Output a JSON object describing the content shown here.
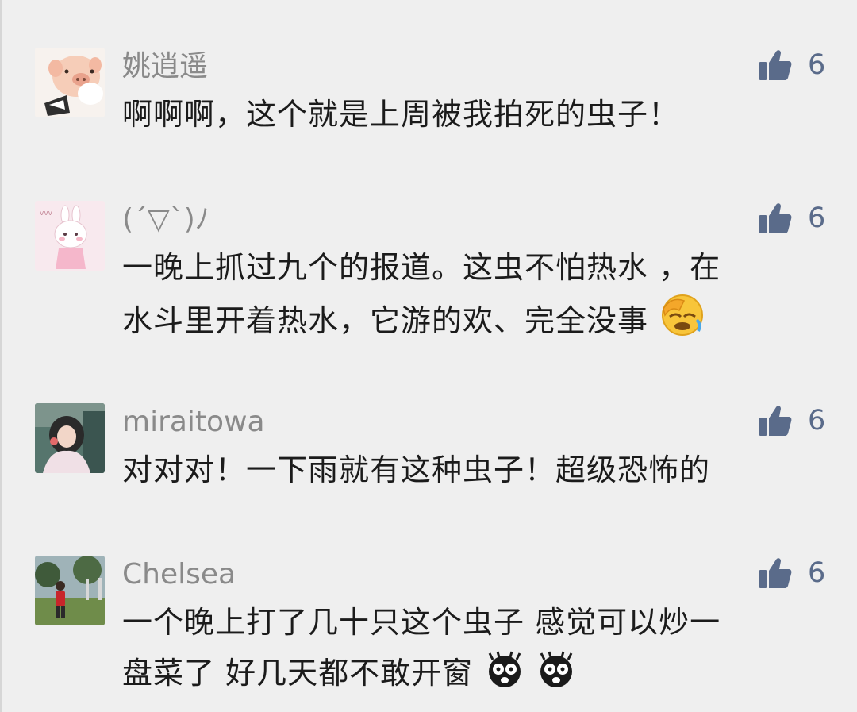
{
  "comments": [
    {
      "name": "姚逍遥",
      "likes": "6",
      "lines": [
        "啊啊啊，这个就是上周被我拍死的虫子！"
      ],
      "avatar_icon": "pig-avatar",
      "emojis": []
    },
    {
      "name": "(´▽`)ﾉ",
      "likes": "6",
      "lines": [
        "一晚上抓过九个的报道。这虫不怕热水 ，在",
        "水斗里开着热水，它游的欢、完全没事"
      ],
      "avatar_icon": "bunny-avatar",
      "emojis": [
        "face-palm-emoji"
      ]
    },
    {
      "name": "miraitowa",
      "likes": "6",
      "lines": [
        "对对对！一下雨就有这种虫子！超级恐怖的"
      ],
      "avatar_icon": "girl-photo-avatar",
      "emojis": []
    },
    {
      "name": "Chelsea",
      "likes": "6",
      "lines": [
        "一个晚上打了几十只这个虫子 感觉可以炒一",
        "盘菜了 好几天都不敢开窗"
      ],
      "avatar_icon": "child-park-avatar",
      "emojis": [
        "scared-face-emoji",
        "scared-face-emoji"
      ]
    }
  ],
  "colors": {
    "background": "#efefef",
    "name": "#8a8a8a",
    "like_icon": "#5a6b8a",
    "text": "#1b1b1b"
  },
  "icons": {
    "like": "thumbs-up-icon"
  }
}
